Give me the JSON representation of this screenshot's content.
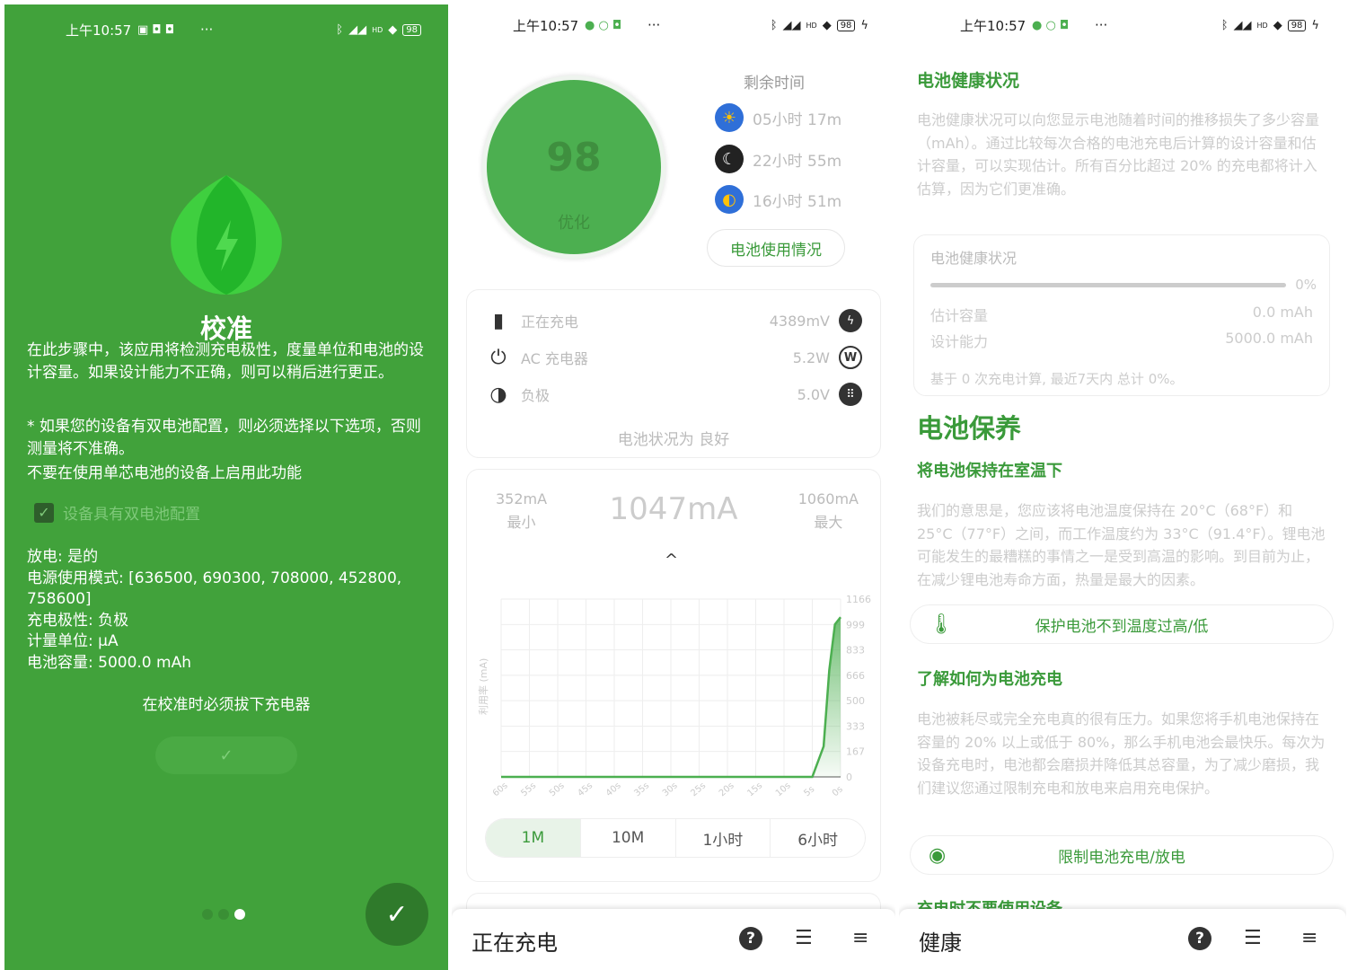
{
  "status_bar": {
    "time": "上午10:57",
    "battery": "98",
    "signal_label": "HD",
    "dots": "···"
  },
  "panel1": {
    "title": "校准",
    "description": "在此步骤中，该应用将检测充电极性，度量单位和电池的设计容量。如果设计能力不正确，则可以稍后进行更正。",
    "dual_note": "* 如果您的设备有双电池配置，则必须选择以下选项，否则测量将不准确。",
    "dual_warning": "不要在使用单芯电池的设备上启用此功能",
    "checkbox_label": "设备具有双电池配置",
    "info": [
      "放电: 是的",
      "电源使用模式: [636500, 690300, 708000, 452800, 758600]",
      "充电极性: 负极",
      "计量单位: μA",
      "电池容量: 5000.0 mAh"
    ],
    "unplug_note": "在校准时必须拔下充电器",
    "confirm_glyph": "✓",
    "fab_glyph": "✓"
  },
  "panel2": {
    "gauge": {
      "value": "98",
      "label": "优化"
    },
    "remaining_title": "剩余时间",
    "remaining": [
      {
        "text": "05小时 17m",
        "icon": "sun-icon"
      },
      {
        "text": "22小时 55m",
        "icon": "moon-icon"
      },
      {
        "text": "16小时 51m",
        "icon": "day-night-icon"
      }
    ],
    "usage_button": "电池使用情况",
    "charging_card": {
      "rows": [
        {
          "label": "正在充电",
          "value": "4389mV",
          "icon": "battery-charging-icon",
          "right": "bolt-icon"
        },
        {
          "label": "AC 充电器",
          "value": "5.2W",
          "icon": "plug-icon",
          "right": "watt-icon"
        },
        {
          "label": "负极",
          "value": "5.0V",
          "icon": "polarity-icon",
          "right": "outlet-icon"
        }
      ],
      "status": "电池状况为 良好"
    },
    "current_card": {
      "min_value": "352mA",
      "min_label": "最小",
      "current": "1047mA",
      "max_value": "1060mA",
      "max_label": "最大",
      "y_axis_label": "利用率 (mA)",
      "y_ticks": [
        "1166",
        "999",
        "833",
        "666",
        "500",
        "333",
        "167",
        "0"
      ],
      "x_ticks": [
        "60s",
        "55s",
        "50s",
        "45s",
        "40s",
        "35s",
        "30s",
        "25s",
        "20s",
        "15s",
        "10s",
        "5s",
        "0s"
      ]
    },
    "tabs": [
      "1M",
      "10M",
      "1小时",
      "6小时"
    ],
    "bottom_title": "正在充电"
  },
  "chart_data": {
    "type": "line",
    "title": "",
    "xlabel": "",
    "ylabel": "利用率 (mA)",
    "x": [
      60,
      55,
      50,
      45,
      40,
      35,
      30,
      25,
      20,
      15,
      10,
      5,
      3,
      2,
      1,
      0
    ],
    "series": [
      {
        "values": [
          0,
          0,
          0,
          0,
          0,
          0,
          0,
          0,
          0,
          0,
          0,
          0,
          200,
          700,
          1000,
          1047
        ]
      }
    ],
    "ylim": [
      0,
      1166
    ],
    "xlim": [
      60,
      0
    ],
    "grid": true
  },
  "panel3": {
    "health_title": "电池健康状况",
    "health_text": "电池健康状况可以向您显示电池随着时间的推移损失了多少容量（mAh）。通过比较每次合格的电池充电后计算的设计容量和估计容量，可以实现估计。所有百分比超过 20% 的充电都将计入估算，因为它们更准确。",
    "health_card": {
      "title": "电池健康状况",
      "percent": "0%",
      "est_label": "估计容量",
      "est_value": "0.0 mAh",
      "design_label": "设计能力",
      "design_value": "5000.0 mAh",
      "footer": "基于 0 次充电计算, 最近7天内 总计 0%。"
    },
    "care_title": "电池保养",
    "room_temp_title": "将电池保持在室温下",
    "room_temp_text": "我们的意思是，您应该将电池温度保持在 20°C（68°F）和 25°C（77°F）之间，而工作温度约为 33°C（91.4°F）。锂电池可能发生的最糟糕的事情之一是受到高温的影响。到目前为止，在减少锂电池寿命方面，热量是最大的因素。",
    "protect_button": "保护电池不到温度过高/低",
    "charge_title": "了解如何为电池充电",
    "charge_text": "电池被耗尽或完全充电真的很有压力。如果您将手机电池保持在容量的 20% 以上或低于 80%，那么手机电池会最快乐。每次为设备充电时，电池都会磨损并降低其总容量，为了减少磨损，我们建议您通过限制充电和放电来启用充电保护。",
    "limit_button": "限制电池充电/放电",
    "partial_title": "充电时不要使用设备",
    "bottom_title": "健康"
  },
  "colors": {
    "green": "#41a23b",
    "accent": "#3a9a3a",
    "gauge": "#4caf50"
  }
}
